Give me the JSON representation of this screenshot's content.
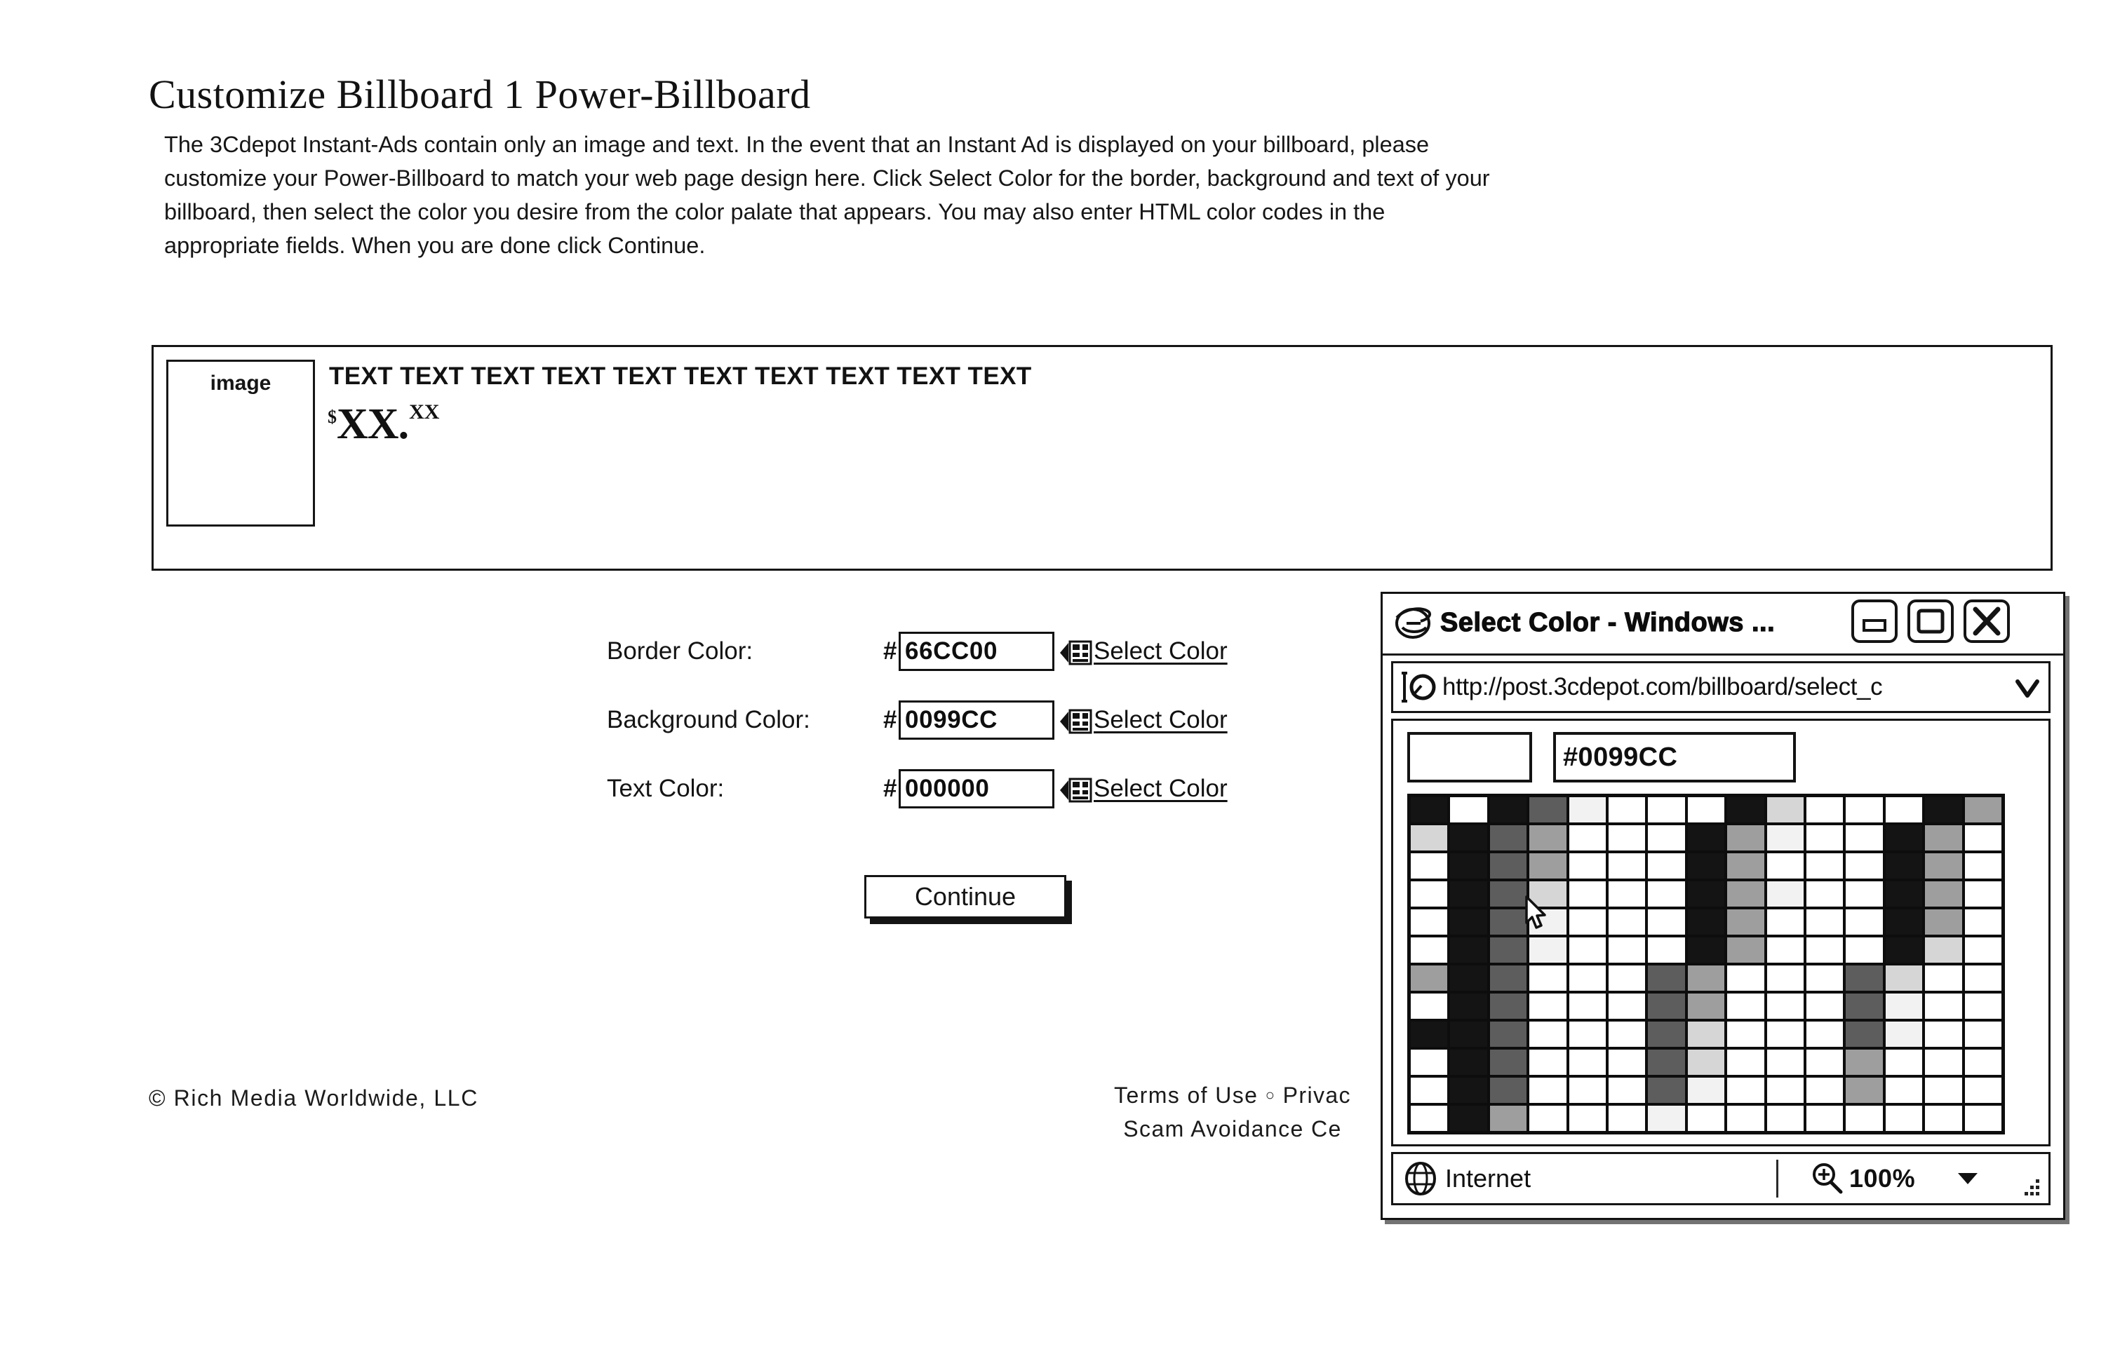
{
  "page": {
    "title": "Customize Billboard 1 Power-Billboard",
    "intro_lines": [
      "The 3Cdepot Instant-Ads contain only an image and text. In the event that an Instant Ad is displayed on your billboard, please",
      "customize your Power-Billboard to match your web page design here. Click Select Color for the border, background and text of your",
      "billboard, then select the color you desire from the color palate that appears. You may also enter HTML color codes in the",
      "appropriate fields. When you are done click Continue."
    ]
  },
  "billboard": {
    "image_placeholder_label": "image",
    "text_line": "TEXT TEXT TEXT TEXT TEXT TEXT TEXT TEXT TEXT TEXT",
    "price_currency": "$",
    "price_dollars": "XX",
    "price_dot": ".",
    "price_cents": "XX"
  },
  "form": {
    "hash": "#",
    "select_color_label": "Select Color",
    "rows": [
      {
        "label": "Border Color:",
        "value": "66CC00"
      },
      {
        "label": "Background Color:",
        "value": "0099CC"
      },
      {
        "label": "Text Color:",
        "value": "000000"
      }
    ],
    "continue_label": "Continue"
  },
  "footer": {
    "copyright": "© Rich Media Worldwide, LLC",
    "link_terms": "Terms of Use",
    "link_separator": "○",
    "link_privacy": "Privac",
    "link_scam": "Scam Avoidance Ce"
  },
  "popup": {
    "title": "Select Color - Windows ...",
    "url": "http://post.3cdepot.com/billboard/select_c",
    "hex_value": "#0099CC",
    "swatch_preview_value": "",
    "status_zone": "Internet",
    "status_zoom": "100%",
    "minimize_label": "",
    "maximize_label": "",
    "close_label": ""
  },
  "colors": {
    "border_color": "#66CC00",
    "background_color": "#0099CC",
    "text_color": "#000000",
    "ink": "#111111",
    "paper": "#FFFFFF"
  },
  "palette": {
    "columns": 15,
    "rows": 12,
    "shades": [
      [
        5,
        0,
        5,
        4,
        1,
        0,
        0,
        0,
        5,
        2,
        0,
        0,
        0,
        5,
        3
      ],
      [
        2,
        5,
        4,
        3,
        0,
        0,
        0,
        5,
        3,
        1,
        0,
        0,
        5,
        3,
        0
      ],
      [
        0,
        5,
        4,
        3,
        0,
        0,
        0,
        5,
        3,
        0,
        0,
        0,
        5,
        3,
        0
      ],
      [
        0,
        5,
        4,
        2,
        0,
        0,
        0,
        5,
        3,
        1,
        0,
        0,
        5,
        3,
        0
      ],
      [
        0,
        5,
        4,
        1,
        0,
        0,
        0,
        5,
        3,
        0,
        0,
        0,
        5,
        3,
        0
      ],
      [
        0,
        5,
        4,
        1,
        0,
        0,
        0,
        5,
        3,
        0,
        0,
        0,
        5,
        2,
        0
      ],
      [
        3,
        5,
        4,
        0,
        0,
        0,
        4,
        3,
        0,
        0,
        0,
        4,
        2,
        0,
        0
      ],
      [
        0,
        5,
        4,
        0,
        0,
        0,
        4,
        3,
        0,
        0,
        0,
        4,
        1,
        0,
        0
      ],
      [
        5,
        5,
        4,
        0,
        0,
        0,
        4,
        2,
        0,
        0,
        0,
        4,
        1,
        0,
        0
      ],
      [
        0,
        5,
        4,
        0,
        0,
        0,
        4,
        2,
        0,
        0,
        0,
        3,
        0,
        0,
        0
      ],
      [
        0,
        5,
        4,
        0,
        0,
        0,
        4,
        1,
        0,
        0,
        0,
        3,
        0,
        0,
        0
      ],
      [
        0,
        5,
        3,
        0,
        0,
        0,
        1,
        0,
        0,
        0,
        0,
        0,
        0,
        0,
        0
      ]
    ]
  }
}
